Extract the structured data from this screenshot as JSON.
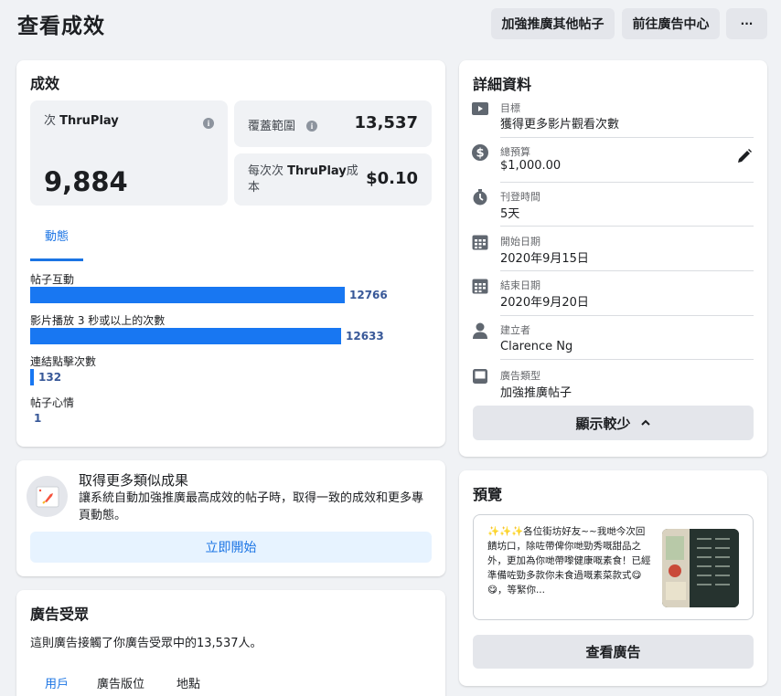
{
  "header": {
    "title": "查看成效",
    "boost_other_posts": "加強推廣其他帖子",
    "ads_center": "前往廣告中心",
    "more": "···"
  },
  "performance": {
    "title": "成效",
    "thruplay_label_prefix": "次 ",
    "thruplay_label_bold": "ThruPlay",
    "thruplay_value": "9,884",
    "reach_label": "覆蓋範圍",
    "reach_value": "13,537",
    "cost_label_prefix": "每次次 ",
    "cost_label_bold": "ThruPlay",
    "cost_label_suffix": "成本",
    "cost_value": "$0.10",
    "tab": "動態",
    "bars": [
      {
        "label": "帖子互動",
        "value": 12766,
        "value_text": "12766"
      },
      {
        "label": "影片播放 3 秒或以上的次數",
        "value": 12633,
        "value_text": "12633"
      },
      {
        "label": "連結點擊次數",
        "value": 132,
        "value_text": "132"
      },
      {
        "label": "帖子心情",
        "value": 1,
        "value_text": "1"
      }
    ],
    "bar_max": 12766
  },
  "promo": {
    "title": "取得更多類似成果",
    "body": "讓系統自動加強推廣最高成效的帖子時，取得一致的成效和更多專頁動態。",
    "button": "立即開始"
  },
  "audience": {
    "title": "廣告受眾",
    "body": "這則廣告接觸了你廣告受眾中的13,537人。",
    "tabs": [
      "用戶",
      "廣告版位",
      "地點"
    ]
  },
  "details": {
    "title": "詳細資料",
    "items": [
      {
        "icon": "video-icon",
        "label": "目標",
        "value": "獲得更多影片觀看次數"
      },
      {
        "icon": "dollar-icon",
        "label": "總預算",
        "value": "$1,000.00"
      },
      {
        "icon": "stopwatch-icon",
        "label": "刊登時間",
        "value": "5天"
      },
      {
        "icon": "calendar-icon",
        "label": "開始日期",
        "value": "2020年9月15日"
      },
      {
        "icon": "calendar-icon",
        "label": "結束日期",
        "value": "2020年9月20日"
      },
      {
        "icon": "person-icon",
        "label": "建立者",
        "value": "Clarence Ng"
      },
      {
        "icon": "ad-type-icon",
        "label": "廣告類型",
        "value": "加強推廣帖子"
      }
    ],
    "show_less": "顯示較少"
  },
  "preview": {
    "title": "預覽",
    "text": "✨✨✨各位街坊好友~~我哋今次回饋坊口，除咗帶俾你哋勁秀嘅甜品之外，更加為你哋帶嚟健康嘅素食！已經準備咗勁多款你未食過嘅素菜款式😋😋，等緊你...",
    "view_ad": "查看廣告"
  }
}
